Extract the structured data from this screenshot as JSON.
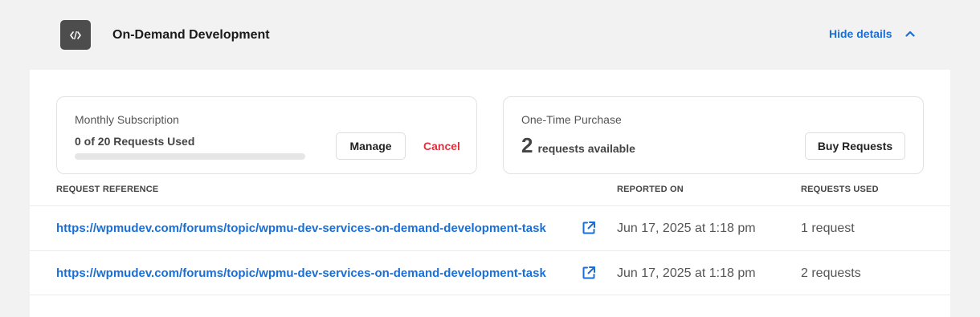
{
  "header": {
    "icon": "code-icon",
    "title": "On-Demand Development",
    "toggle_label": "Hide details",
    "toggle_icon": "chevron-up-icon"
  },
  "subscription": {
    "title": "Monthly Subscription",
    "usage_text": "0 of 20 Requests Used",
    "used": 0,
    "total": 20,
    "manage_label": "Manage",
    "cancel_label": "Cancel"
  },
  "one_time": {
    "title": "One-Time Purchase",
    "count": "2",
    "count_label": "requests available",
    "buy_label": "Buy Requests"
  },
  "table": {
    "headers": {
      "reference": "REQUEST REFERENCE",
      "reported": "REPORTED ON",
      "used": "REQUESTS USED"
    },
    "rows": [
      {
        "reference": "https://wpmudev.com/forums/topic/wpmu-dev-services-on-demand-development-task",
        "reported": "Jun 17, 2025 at 1:18 pm",
        "used": "1 request"
      },
      {
        "reference": "https://wpmudev.com/forums/topic/wpmu-dev-services-on-demand-development-task",
        "reported": "Jun 17, 2025 at 1:18 pm",
        "used": "2 requests"
      }
    ]
  },
  "colors": {
    "accent": "#1a6fd6",
    "danger": "#e0313e",
    "icon_bg": "#4d4d4d"
  }
}
